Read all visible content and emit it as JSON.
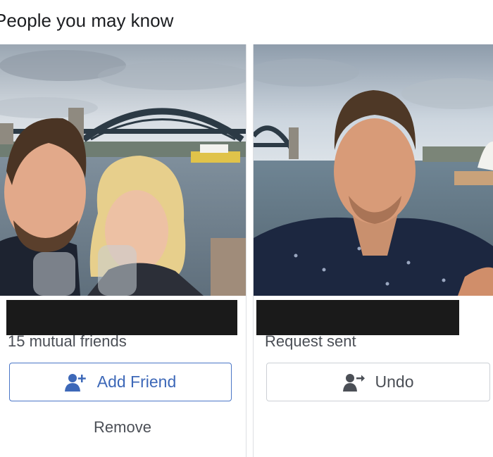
{
  "section": {
    "title": "People you may know"
  },
  "cards": [
    {
      "subtitle": "15 mutual friends",
      "primary_action": {
        "label": "Add Friend",
        "icon": "add-friend-icon"
      },
      "secondary_action": {
        "label": "Remove"
      }
    },
    {
      "subtitle": "Request sent",
      "primary_action": {
        "label": "Undo",
        "icon": "undo-request-icon"
      }
    }
  ],
  "colors": {
    "accent": "#3d68b8",
    "accent_border": "#4a76c7",
    "redaction": "#1a1a1a",
    "text": "#4b4f56"
  }
}
